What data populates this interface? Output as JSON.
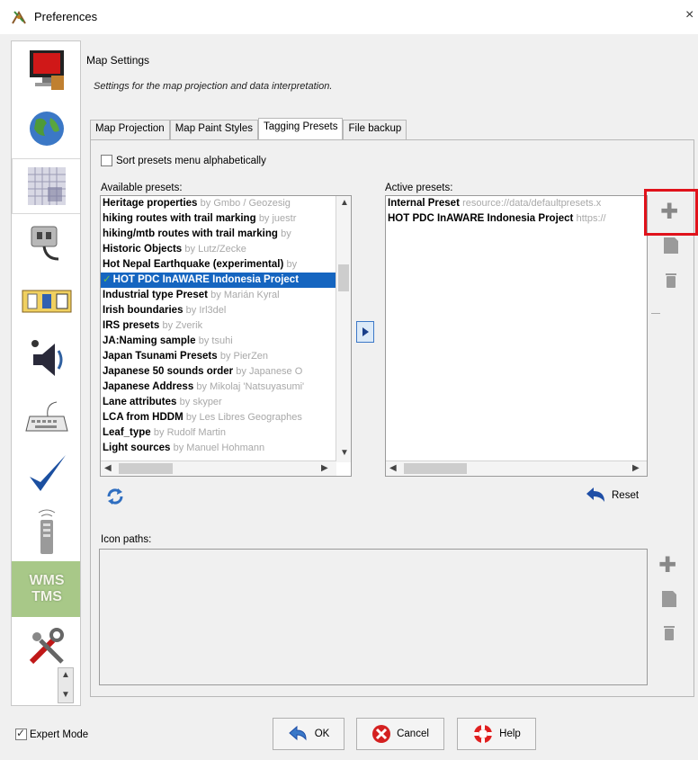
{
  "window": {
    "title": "Preferences",
    "close_glyph": "×"
  },
  "header": {
    "title": "Map Settings",
    "description": "Settings for the map projection and data interpretation."
  },
  "tabs": [
    {
      "label": "Map Projection",
      "active": false
    },
    {
      "label": "Map Paint Styles",
      "active": false
    },
    {
      "label": "Tagging Presets",
      "active": true
    },
    {
      "label": "File backup",
      "active": false
    }
  ],
  "sort": {
    "label": "Sort presets menu alphabetically",
    "checked": false
  },
  "available": {
    "label": "Available presets:",
    "items": [
      {
        "name": "Heritage properties",
        "author": "by Gmbo / Geozesig"
      },
      {
        "name": "hiking routes with trail marking",
        "author": "by juestr"
      },
      {
        "name": "hiking/mtb routes with trail marking",
        "author": "by"
      },
      {
        "name": "Historic Objects",
        "author": "by Lutz/Zecke"
      },
      {
        "name": "Hot Nepal Earthquake (experimental)",
        "author": "by"
      },
      {
        "name": "HOT PDC InAWARE Indonesia Project",
        "author": "",
        "selected": true,
        "check": "✓"
      },
      {
        "name": "Industrial type Preset",
        "author": "by Marián Kyral"
      },
      {
        "name": "Irish boundaries",
        "author": "by Irl3del"
      },
      {
        "name": "IRS presets",
        "author": "by Zverik"
      },
      {
        "name": "JA:Naming sample",
        "author": "by tsuhi"
      },
      {
        "name": "Japan Tsunami Presets",
        "author": "by PierZen"
      },
      {
        "name": "Japanese 50 sounds order",
        "author": "by Japanese O"
      },
      {
        "name": "Japanese Address",
        "author": "by Mikolaj 'Natsuyasumi'"
      },
      {
        "name": "Lane attributes",
        "author": "by skyper"
      },
      {
        "name": "LCA from HDDM",
        "author": "by Les Libres Geographes"
      },
      {
        "name": "Leaf_type",
        "author": "by Rudolf Martin"
      },
      {
        "name": "Light sources",
        "author": "by Manuel Hohmann"
      }
    ]
  },
  "active": {
    "label": "Active presets:",
    "items": [
      {
        "name": "Internal Preset",
        "source": "resource://data/defaultpresets.x"
      },
      {
        "name": "HOT PDC InAWARE Indonesia Project",
        "source": "https://"
      }
    ]
  },
  "reset_label": "Reset",
  "icon_paths_label": "Icon paths:",
  "footer": {
    "expert_label": "Expert Mode",
    "expert_checked": true,
    "ok_label": "OK",
    "cancel_label": "Cancel",
    "help_label": "Help"
  },
  "categories": [
    {
      "icon": "display-icon"
    },
    {
      "icon": "globe-icon"
    },
    {
      "icon": "map-grid-icon",
      "selected": true
    },
    {
      "icon": "plugin-plug-icon"
    },
    {
      "icon": "toolbar-icon"
    },
    {
      "icon": "audio-speaker-icon"
    },
    {
      "icon": "keyboard-icon"
    },
    {
      "icon": "checkmark-icon"
    },
    {
      "icon": "remote-control-icon"
    },
    {
      "icon": "wms-tms-icon",
      "text_line1": "WMS",
      "text_line2": "TMS"
    },
    {
      "icon": "tools-icon"
    }
  ],
  "colors": {
    "selection": "#1565c0",
    "highlight_box": "#e0121b",
    "author_text": "#a8a8a8"
  }
}
